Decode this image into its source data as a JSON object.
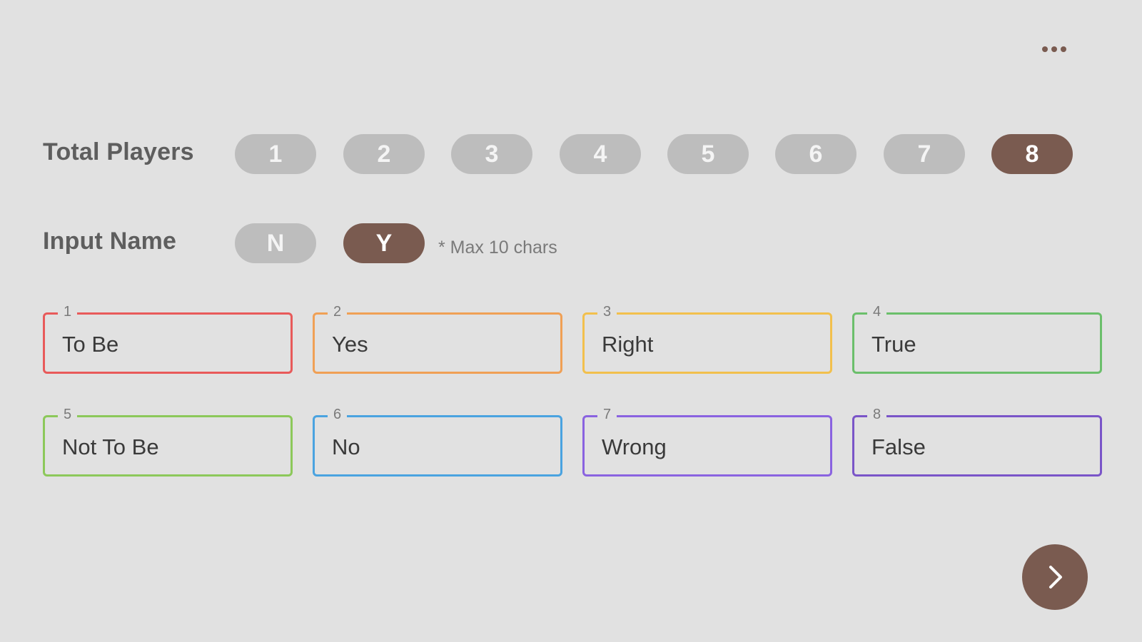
{
  "header": {
    "more_icon": "more-horizontal-icon"
  },
  "settings": {
    "total_players_label": "Total Players",
    "player_counts": [
      "1",
      "2",
      "3",
      "4",
      "5",
      "6",
      "7",
      "8"
    ],
    "selected_player_count": "8",
    "input_name_label": "Input Name",
    "input_name_options": [
      "N",
      "Y"
    ],
    "selected_input_name": "Y",
    "input_name_hint": "* Max 10 chars"
  },
  "players": [
    {
      "number": "1",
      "name": "To Be",
      "color": "#e85a5a"
    },
    {
      "number": "2",
      "name": "Yes",
      "color": "#f0a055"
    },
    {
      "number": "3",
      "name": "Right",
      "color": "#f2c04d"
    },
    {
      "number": "4",
      "name": "True",
      "color": "#6bbf6b"
    },
    {
      "number": "5",
      "name": "Not To Be",
      "color": "#8cc85a"
    },
    {
      "number": "6",
      "name": "No",
      "color": "#4aa3e0"
    },
    {
      "number": "7",
      "name": "Wrong",
      "color": "#8a63e0"
    },
    {
      "number": "8",
      "name": "False",
      "color": "#7a55c8"
    }
  ],
  "footer": {
    "next_icon": "chevron-right-icon"
  },
  "colors": {
    "accent": "#7a5b50",
    "inactive_pill": "#bdbdbd",
    "background": "#e1e1e1"
  }
}
